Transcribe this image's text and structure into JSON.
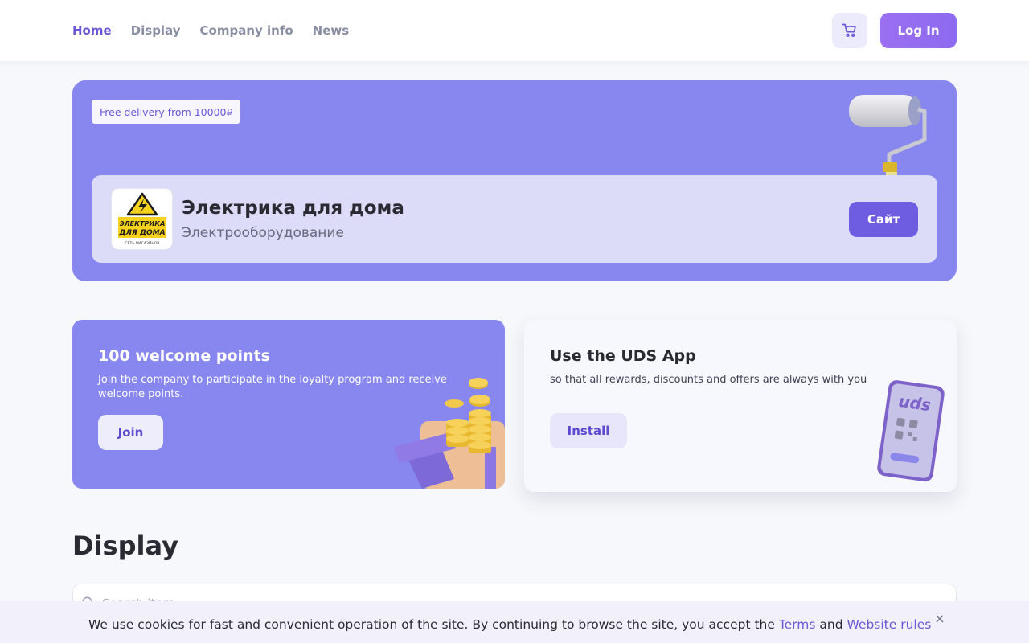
{
  "nav": {
    "items": [
      {
        "label": "Home",
        "active": true
      },
      {
        "label": "Display"
      },
      {
        "label": "Company info"
      },
      {
        "label": "News"
      }
    ],
    "cart_icon": "cart-icon",
    "login_label": "Log In"
  },
  "hero": {
    "badge": "Free delivery from 10000₽",
    "company_name": "Электрика для дома",
    "company_category": "Электрооборудование",
    "logo_line1": "ЭЛЕКТРИКА",
    "logo_line2": "ДЛЯ ДОМА",
    "logo_line3": "СЕТЬ МАГАЗИНОВ",
    "site_button": "Сайт"
  },
  "promo": {
    "welcome_title": "100 welcome points",
    "welcome_text": "Join the company to participate in the loyalty program and receive welcome points.",
    "join_button": "Join",
    "app_title": "Use the UDS App",
    "app_text": "so that all rewards, discounts and offers are always with you",
    "install_button": "Install",
    "phone_label": "uds"
  },
  "display": {
    "title": "Display",
    "search_placeholder": "Search item"
  },
  "cookie": {
    "text_before": "We use cookies for fast and convenient operation of the site. By continuing to browse the site, you accept the ",
    "terms_link": "Terms",
    "and": " and ",
    "rules_link": "Website rules",
    "close_label": "×"
  },
  "colors": {
    "accent": "#6b57d6",
    "hero_bg": "#8886ef",
    "card_bg": "#dcdbf8"
  }
}
